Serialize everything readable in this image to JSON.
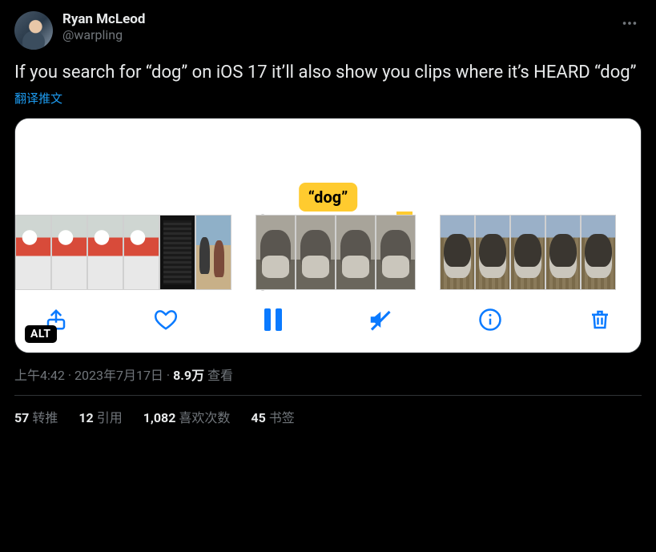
{
  "author": {
    "display_name": "Ryan McLeod",
    "handle": "@warpling"
  },
  "tweet_text": "If you search for “dog” on iOS 17 it’ll also show you clips where it’s HEARD “dog”",
  "translate_label": "翻译推文",
  "media": {
    "search_bubble": "“dog”",
    "alt_badge": "ALT"
  },
  "meta": {
    "time": "上午4:42",
    "date": "2023年7月17日",
    "views_count": "8.9万",
    "views_label": "查看",
    "separator": " · "
  },
  "stats": {
    "retweets": {
      "count": "57",
      "label": "转推"
    },
    "quotes": {
      "count": "12",
      "label": "引用"
    },
    "likes": {
      "count": "1,082",
      "label": "喜欢次数"
    },
    "bookmarks": {
      "count": "45",
      "label": "书签"
    }
  }
}
